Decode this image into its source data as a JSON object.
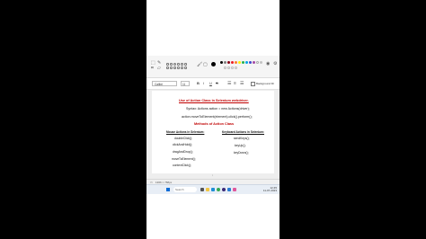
{
  "toolbar": {
    "swatch_colors": [
      "#000000",
      "#7f7f7f",
      "#880015",
      "#ed1c24",
      "#ff7f27",
      "#fff200",
      "#22b14c",
      "#00a2e8",
      "#3f48cc",
      "#a349a4",
      "#ffffff",
      "#c3c3c3"
    ],
    "brush_icon": "brush-icon",
    "shapes_icon": "shapes-icon"
  },
  "textbar": {
    "font": "Calibri",
    "size": "11",
    "bold": "B",
    "italic": "I",
    "underline": "U",
    "strike": "S",
    "background_label": "Background fill"
  },
  "document": {
    "title": "Use of Action Class in Selenium webdriver.",
    "syntax": "Syntax: Actions action = new Actions(driver);",
    "example": "action.moveToElement(element).click().perform();",
    "methods_heading": "Methods of Action Class",
    "mouse_heading": "Mouse Actions in Selenium:",
    "keyboard_heading": "Keyboard Actions in Selenium:",
    "mouse_items": [
      "doubleClick();",
      "clickAndHold();",
      "dragAndDrop();",
      "moveToElement();",
      "contextClick();"
    ],
    "keyboard_items": [
      "sendKeys();",
      "keyUp();",
      "keyDown();"
    ]
  },
  "status": {
    "size": "1366 × 768px"
  },
  "taskbar": {
    "search_placeholder": "Search",
    "time": "12:45",
    "date": "11-07-2023"
  }
}
